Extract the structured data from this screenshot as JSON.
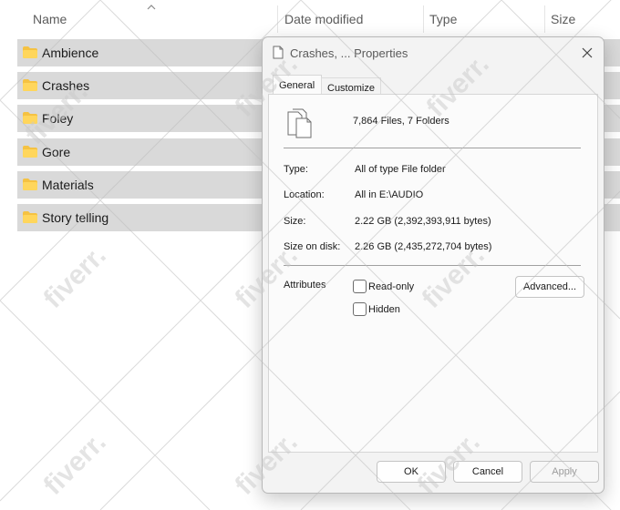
{
  "explorer": {
    "columns": {
      "name": "Name",
      "date_modified": "Date modified",
      "type": "Type",
      "size": "Size"
    },
    "folders": [
      {
        "label": "Ambience"
      },
      {
        "label": "Crashes"
      },
      {
        "label": "Foley"
      },
      {
        "label": "Gore"
      },
      {
        "label": "Materials"
      },
      {
        "label": "Story telling"
      }
    ]
  },
  "dialog": {
    "title": "Crashes, ... Properties",
    "tabs": [
      "General",
      "Customize"
    ],
    "summary": "7,864 Files, 7 Folders",
    "properties": {
      "type_label": "Type:",
      "type_value": "All of type File folder",
      "location_label": "Location:",
      "location_value": "All in E:\\AUDIO",
      "size_label": "Size:",
      "size_value": "2.22 GB (2,392,393,911 bytes)",
      "size_on_disk_label": "Size on disk:",
      "size_on_disk_value": "2.26 GB (2,435,272,704 bytes)"
    },
    "attributes": {
      "label": "Attributes",
      "read_only": "Read-only",
      "hidden": "Hidden",
      "advanced_button": "Advanced..."
    },
    "buttons": {
      "ok": "OK",
      "cancel": "Cancel",
      "apply": "Apply"
    }
  },
  "watermark": "fiverr.",
  "colors": {
    "row_highlight": "#d9d9d9",
    "folder_yellow": "#f5c242",
    "dialog_bg": "#f3f3f3"
  }
}
